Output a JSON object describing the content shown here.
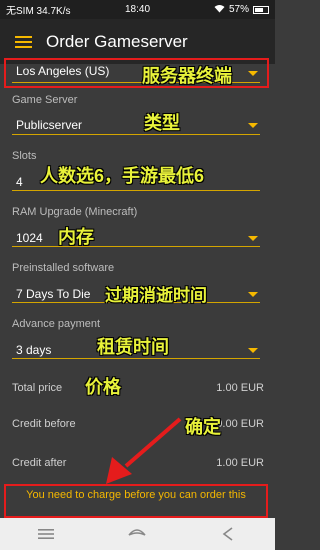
{
  "status_bar": {
    "left_text": "无SIM 34.7K/s",
    "time": "18:40",
    "battery": "57%"
  },
  "toolbar": {
    "title": "Order Gameserver"
  },
  "form": {
    "location": {
      "value": "Los Angeles (US)"
    },
    "game_server": {
      "label": "Game Server",
      "value": "Publicserver"
    },
    "slots": {
      "label": "Slots",
      "value": "4"
    },
    "ram": {
      "label": "RAM Upgrade (Minecraft)",
      "value": "1024"
    },
    "software": {
      "label": "Preinstalled software",
      "value": "7 Days To Die"
    },
    "payment": {
      "label": "Advance payment",
      "value": "3 days"
    }
  },
  "prices": {
    "total": {
      "label": "Total price",
      "value": "1.00 EUR"
    },
    "credit_before": {
      "label": "Credit before",
      "value": "0.00 EUR"
    },
    "credit_after": {
      "label": "Credit after",
      "value": "1.00 EUR"
    }
  },
  "warning": {
    "text": "You need to charge before you can order this"
  },
  "annotations": {
    "server_location": "服务器终端",
    "type": "类型",
    "slots_note": "人数选6，手游最低6",
    "memory": "内存",
    "expiry": "过期消逝时间",
    "rental_time": "租赁时间",
    "price": "价格",
    "confirm": "确定"
  },
  "colors": {
    "accent": "#f5b800",
    "annotation": "#e8f23a",
    "highlight_red": "#e51c1c"
  }
}
